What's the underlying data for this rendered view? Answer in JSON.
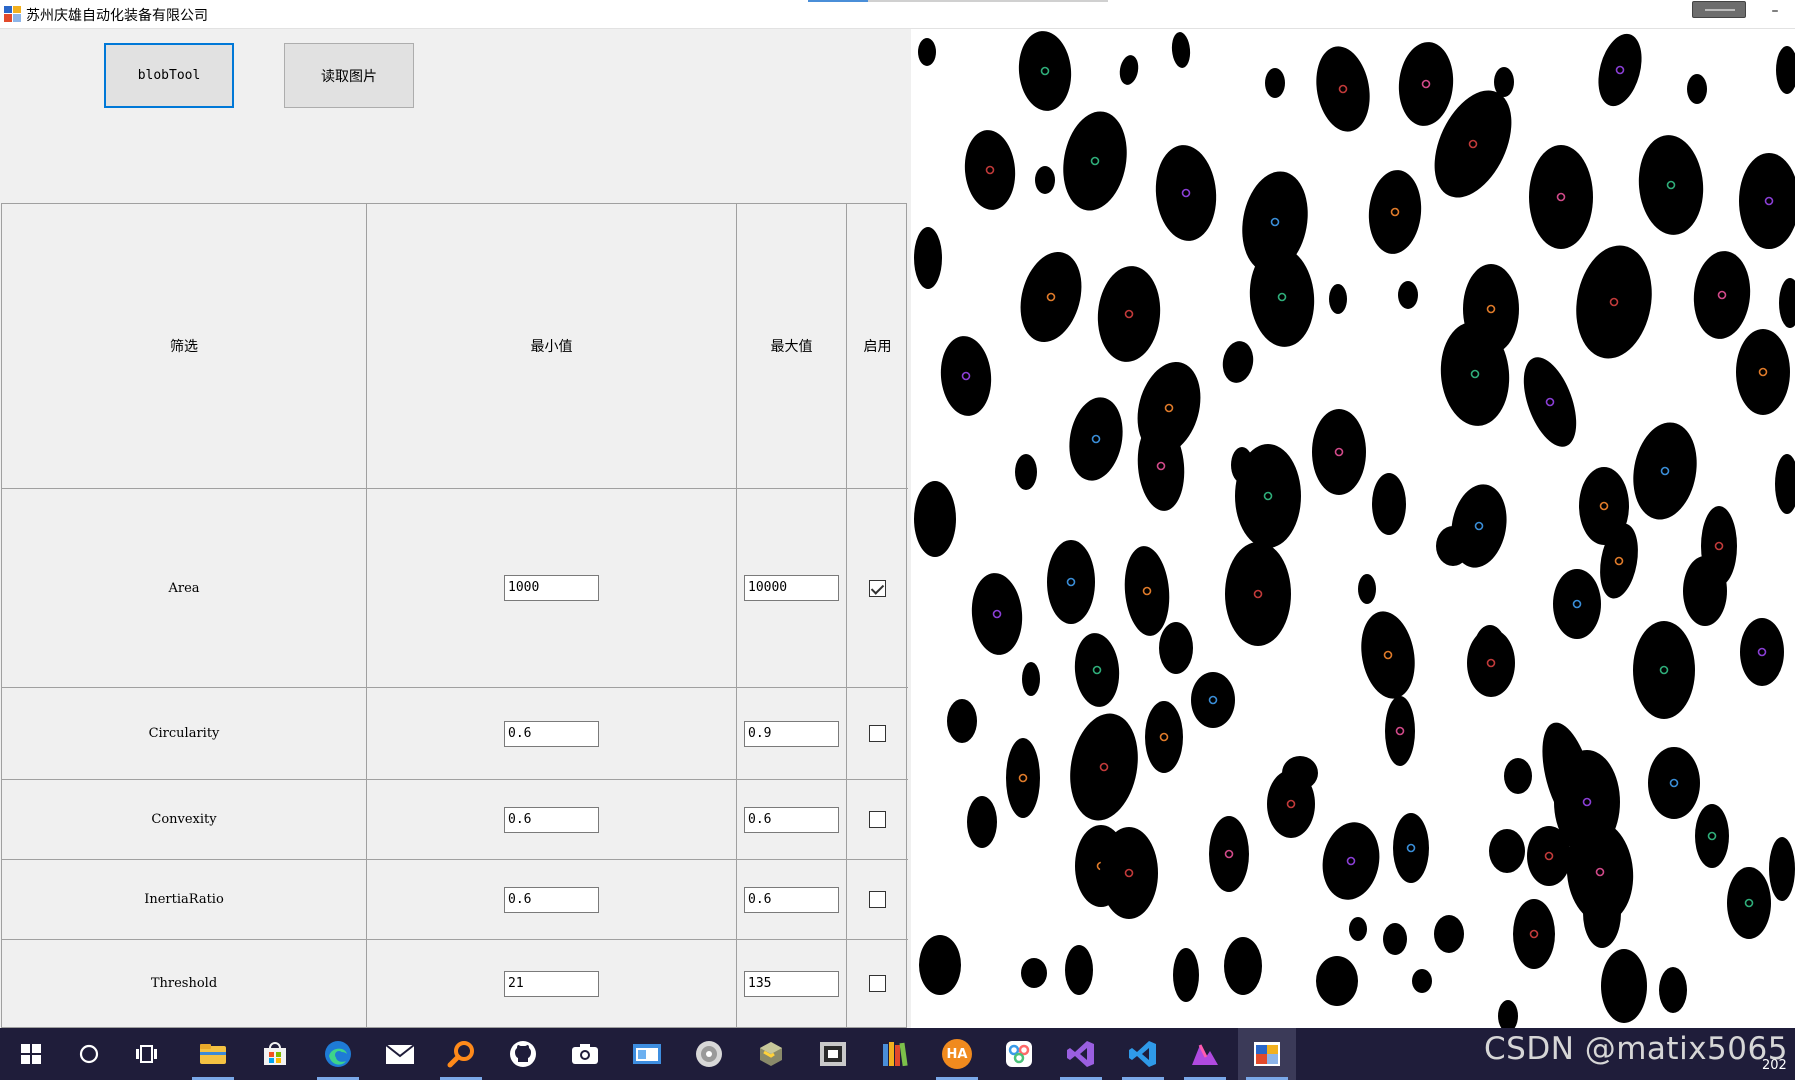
{
  "window": {
    "title": "苏州庆雄自动化装备有限公司",
    "minimize_glyph": "–"
  },
  "buttons": {
    "blob_tool": "blobTool",
    "read_image": "读取图片"
  },
  "table": {
    "headers": [
      "筛选",
      "最小值",
      "最大值",
      "启用"
    ],
    "rows": [
      {
        "label": "Area",
        "min": "1000",
        "max": "10000",
        "enabled": true
      },
      {
        "label": "Circularity",
        "min": "0.6",
        "max": "0.9",
        "enabled": false
      },
      {
        "label": "Convexity",
        "min": "0.6",
        "max": "0.6",
        "enabled": false
      },
      {
        "label": "InertiaRatio",
        "min": "0.6",
        "max": "0.6",
        "enabled": false
      },
      {
        "label": "Threshold",
        "min": "21",
        "max": "135",
        "enabled": false
      }
    ]
  },
  "image_panel": {
    "marker_colors": [
      "#d24a8a",
      "#2fae7a",
      "#8b3fd6",
      "#3a8ed8",
      "#e07b2a",
      "#c23a3a"
    ]
  },
  "taskbar": {
    "items": [
      {
        "name": "start-icon"
      },
      {
        "name": "search-icon"
      },
      {
        "name": "task-view-icon"
      },
      {
        "name": "file-explorer-icon"
      },
      {
        "name": "store-icon"
      },
      {
        "name": "edge-icon"
      },
      {
        "name": "mail-icon"
      },
      {
        "name": "search-app-icon"
      },
      {
        "name": "github-icon"
      },
      {
        "name": "camera-icon"
      },
      {
        "name": "window-app-icon"
      },
      {
        "name": "disc-icon"
      },
      {
        "name": "package-icon"
      },
      {
        "name": "terminal-app-icon"
      },
      {
        "name": "books-icon"
      },
      {
        "name": "ha-app-icon",
        "text": "HA"
      },
      {
        "name": "network-app-icon"
      },
      {
        "name": "visual-studio-icon"
      },
      {
        "name": "vscode-icon"
      },
      {
        "name": "creative-app-icon"
      },
      {
        "name": "this-app-icon"
      }
    ],
    "watermark": "CSDN @matix5065",
    "clock_fragment": "202"
  }
}
